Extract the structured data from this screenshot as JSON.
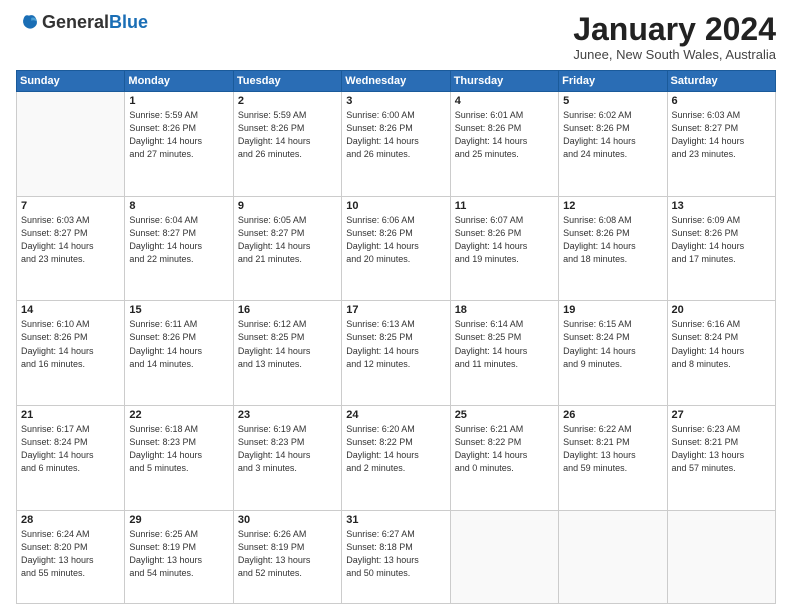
{
  "logo": {
    "general": "General",
    "blue": "Blue"
  },
  "header": {
    "month": "January 2024",
    "location": "Junee, New South Wales, Australia"
  },
  "weekdays": [
    "Sunday",
    "Monday",
    "Tuesday",
    "Wednesday",
    "Thursday",
    "Friday",
    "Saturday"
  ],
  "weeks": [
    [
      {
        "day": "",
        "info": ""
      },
      {
        "day": "1",
        "info": "Sunrise: 5:59 AM\nSunset: 8:26 PM\nDaylight: 14 hours\nand 27 minutes."
      },
      {
        "day": "2",
        "info": "Sunrise: 5:59 AM\nSunset: 8:26 PM\nDaylight: 14 hours\nand 26 minutes."
      },
      {
        "day": "3",
        "info": "Sunrise: 6:00 AM\nSunset: 8:26 PM\nDaylight: 14 hours\nand 26 minutes."
      },
      {
        "day": "4",
        "info": "Sunrise: 6:01 AM\nSunset: 8:26 PM\nDaylight: 14 hours\nand 25 minutes."
      },
      {
        "day": "5",
        "info": "Sunrise: 6:02 AM\nSunset: 8:26 PM\nDaylight: 14 hours\nand 24 minutes."
      },
      {
        "day": "6",
        "info": "Sunrise: 6:03 AM\nSunset: 8:27 PM\nDaylight: 14 hours\nand 23 minutes."
      }
    ],
    [
      {
        "day": "7",
        "info": "Sunrise: 6:03 AM\nSunset: 8:27 PM\nDaylight: 14 hours\nand 23 minutes."
      },
      {
        "day": "8",
        "info": "Sunrise: 6:04 AM\nSunset: 8:27 PM\nDaylight: 14 hours\nand 22 minutes."
      },
      {
        "day": "9",
        "info": "Sunrise: 6:05 AM\nSunset: 8:27 PM\nDaylight: 14 hours\nand 21 minutes."
      },
      {
        "day": "10",
        "info": "Sunrise: 6:06 AM\nSunset: 8:26 PM\nDaylight: 14 hours\nand 20 minutes."
      },
      {
        "day": "11",
        "info": "Sunrise: 6:07 AM\nSunset: 8:26 PM\nDaylight: 14 hours\nand 19 minutes."
      },
      {
        "day": "12",
        "info": "Sunrise: 6:08 AM\nSunset: 8:26 PM\nDaylight: 14 hours\nand 18 minutes."
      },
      {
        "day": "13",
        "info": "Sunrise: 6:09 AM\nSunset: 8:26 PM\nDaylight: 14 hours\nand 17 minutes."
      }
    ],
    [
      {
        "day": "14",
        "info": "Sunrise: 6:10 AM\nSunset: 8:26 PM\nDaylight: 14 hours\nand 16 minutes."
      },
      {
        "day": "15",
        "info": "Sunrise: 6:11 AM\nSunset: 8:26 PM\nDaylight: 14 hours\nand 14 minutes."
      },
      {
        "day": "16",
        "info": "Sunrise: 6:12 AM\nSunset: 8:25 PM\nDaylight: 14 hours\nand 13 minutes."
      },
      {
        "day": "17",
        "info": "Sunrise: 6:13 AM\nSunset: 8:25 PM\nDaylight: 14 hours\nand 12 minutes."
      },
      {
        "day": "18",
        "info": "Sunrise: 6:14 AM\nSunset: 8:25 PM\nDaylight: 14 hours\nand 11 minutes."
      },
      {
        "day": "19",
        "info": "Sunrise: 6:15 AM\nSunset: 8:24 PM\nDaylight: 14 hours\nand 9 minutes."
      },
      {
        "day": "20",
        "info": "Sunrise: 6:16 AM\nSunset: 8:24 PM\nDaylight: 14 hours\nand 8 minutes."
      }
    ],
    [
      {
        "day": "21",
        "info": "Sunrise: 6:17 AM\nSunset: 8:24 PM\nDaylight: 14 hours\nand 6 minutes."
      },
      {
        "day": "22",
        "info": "Sunrise: 6:18 AM\nSunset: 8:23 PM\nDaylight: 14 hours\nand 5 minutes."
      },
      {
        "day": "23",
        "info": "Sunrise: 6:19 AM\nSunset: 8:23 PM\nDaylight: 14 hours\nand 3 minutes."
      },
      {
        "day": "24",
        "info": "Sunrise: 6:20 AM\nSunset: 8:22 PM\nDaylight: 14 hours\nand 2 minutes."
      },
      {
        "day": "25",
        "info": "Sunrise: 6:21 AM\nSunset: 8:22 PM\nDaylight: 14 hours\nand 0 minutes."
      },
      {
        "day": "26",
        "info": "Sunrise: 6:22 AM\nSunset: 8:21 PM\nDaylight: 13 hours\nand 59 minutes."
      },
      {
        "day": "27",
        "info": "Sunrise: 6:23 AM\nSunset: 8:21 PM\nDaylight: 13 hours\nand 57 minutes."
      }
    ],
    [
      {
        "day": "28",
        "info": "Sunrise: 6:24 AM\nSunset: 8:20 PM\nDaylight: 13 hours\nand 55 minutes."
      },
      {
        "day": "29",
        "info": "Sunrise: 6:25 AM\nSunset: 8:19 PM\nDaylight: 13 hours\nand 54 minutes."
      },
      {
        "day": "30",
        "info": "Sunrise: 6:26 AM\nSunset: 8:19 PM\nDaylight: 13 hours\nand 52 minutes."
      },
      {
        "day": "31",
        "info": "Sunrise: 6:27 AM\nSunset: 8:18 PM\nDaylight: 13 hours\nand 50 minutes."
      },
      {
        "day": "",
        "info": ""
      },
      {
        "day": "",
        "info": ""
      },
      {
        "day": "",
        "info": ""
      }
    ]
  ]
}
